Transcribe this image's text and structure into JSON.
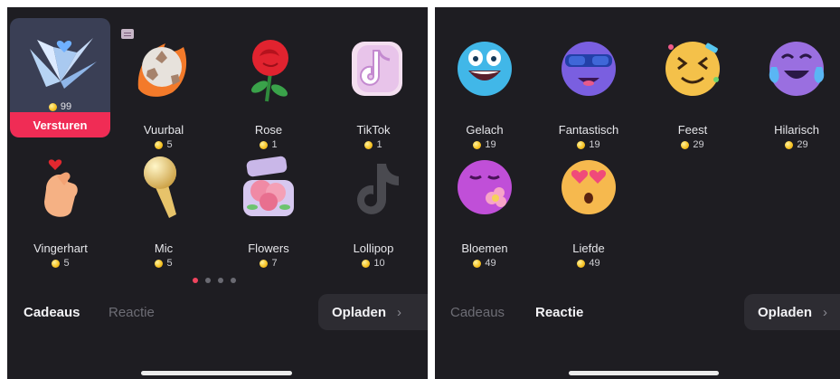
{
  "left": {
    "selected_gift": {
      "price": "99",
      "send_label": "Versturen"
    },
    "gifts": [
      {
        "name": "Vuurbal",
        "price": "5",
        "icon": "fireball-icon"
      },
      {
        "name": "Rose",
        "price": "1",
        "icon": "rose-icon"
      },
      {
        "name": "TikTok",
        "price": "1",
        "icon": "tiktok-note-icon"
      },
      {
        "name": "Vingerhart",
        "price": "5",
        "icon": "finger-heart-icon"
      },
      {
        "name": "Mic",
        "price": "5",
        "icon": "microphone-icon"
      },
      {
        "name": "Flowers",
        "price": "7",
        "icon": "flower-box-icon"
      },
      {
        "name": "Lollipop",
        "price": "10",
        "icon": "tiktok-logo-icon"
      }
    ],
    "page_dots": {
      "count": 4,
      "active_index": 0
    },
    "tabs": [
      "Cadeaus",
      "Reactie"
    ],
    "active_tab": "Cadeaus",
    "recharge_label": "Opladen",
    "accent": "#f02c55"
  },
  "right": {
    "reactions": [
      {
        "name": "Gelach",
        "price": "19",
        "icon": "laughing-face-icon"
      },
      {
        "name": "Fantastisch",
        "price": "19",
        "icon": "cool-sunglasses-face-icon"
      },
      {
        "name": "Feest",
        "price": "29",
        "icon": "party-face-icon"
      },
      {
        "name": "Hilarisch",
        "price": "29",
        "icon": "crying-laughing-face-icon"
      },
      {
        "name": "Bloemen",
        "price": "49",
        "icon": "flower-face-icon"
      },
      {
        "name": "Liefde",
        "price": "49",
        "icon": "heart-eyes-face-icon"
      }
    ],
    "tabs": [
      "Cadeaus",
      "Reactie"
    ],
    "active_tab": "Reactie",
    "recharge_label": "Opladen"
  }
}
